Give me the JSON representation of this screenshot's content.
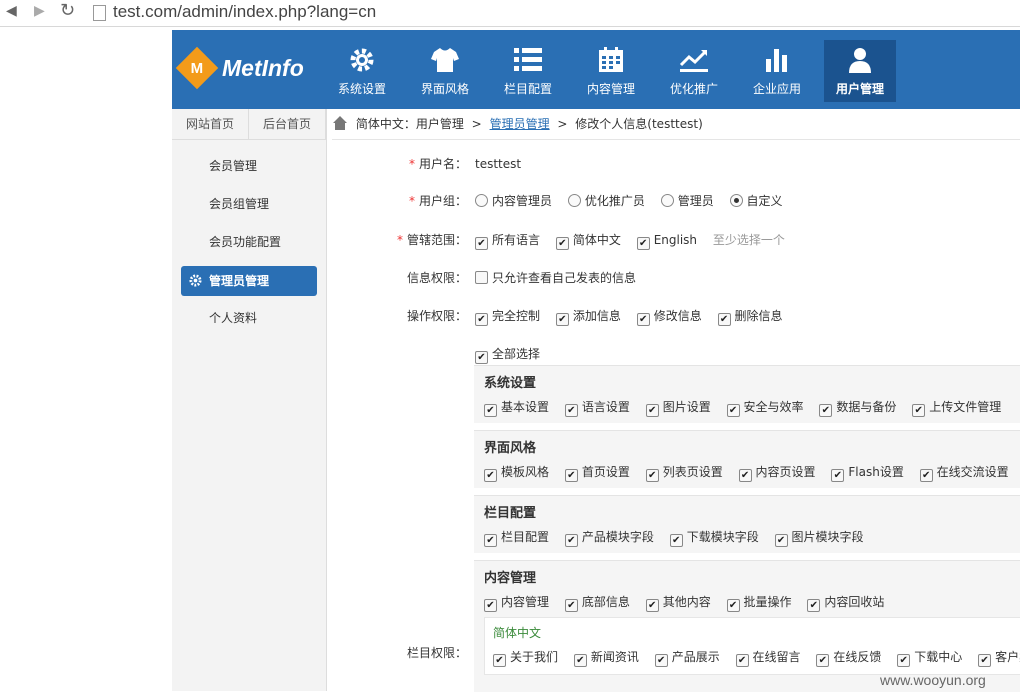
{
  "browser": {
    "url": "test.com/admin/index.php?lang=cn",
    "back": "◀",
    "forward": "▶",
    "reload": "↻"
  },
  "app": {
    "logo_letter": "M",
    "logo_text": "MetInfo"
  },
  "nav": [
    {
      "label": "系统设置",
      "icon": "gear-icon"
    },
    {
      "label": "界面风格",
      "icon": "tshirt-icon"
    },
    {
      "label": "栏目配置",
      "icon": "list-icon"
    },
    {
      "label": "内容管理",
      "icon": "calendar-icon"
    },
    {
      "label": "优化推广",
      "icon": "trend-icon"
    },
    {
      "label": "企业应用",
      "icon": "bar-chart-icon"
    },
    {
      "label": "用户管理",
      "icon": "user-icon"
    }
  ],
  "sidebar": {
    "top": [
      "网站首页",
      "后台首页"
    ],
    "items": [
      "会员管理",
      "会员组管理",
      "会员功能配置",
      "管理员管理",
      "个人资料"
    ]
  },
  "breadcrumb": {
    "part1": "简体中文：用户管理",
    "sep": ">",
    "link": "管理员管理",
    "current": "修改个人信息(testtest)"
  },
  "form": {
    "username": {
      "label": "用户名：",
      "value": "testtest"
    },
    "usergroup": {
      "label": "用户组：",
      "options": [
        "内容管理员",
        "优化推广员",
        "管理员",
        "自定义"
      ]
    },
    "scope": {
      "label": "管辖范围：",
      "options": [
        "所有语言",
        "简体中文",
        "English"
      ],
      "hint": "至少选择一个"
    },
    "info_perm": {
      "label": "信息权限：",
      "option": "只允许查看自己发表的信息"
    },
    "op_perm": {
      "label": "操作权限：",
      "options": [
        "完全控制",
        "添加信息",
        "修改信息",
        "删除信息"
      ]
    },
    "column_perm": {
      "label": "栏目权限：",
      "select_all": "全部选择"
    }
  },
  "groups": [
    {
      "title": "系统设置",
      "items": [
        "基本设置",
        "语言设置",
        "图片设置",
        "安全与效率",
        "数据与备份",
        "上传文件管理"
      ]
    },
    {
      "title": "界面风格",
      "items": [
        "模板风格",
        "首页设置",
        "列表页设置",
        "内容页设置",
        "Flash设置",
        "在线交流设置"
      ]
    },
    {
      "title": "栏目配置",
      "items": [
        "栏目配置",
        "产品模块字段",
        "下载模块字段",
        "图片模块字段"
      ]
    },
    {
      "title": "内容管理",
      "items": [
        "内容管理",
        "底部信息",
        "其他内容",
        "批量操作",
        "内容回收站"
      ]
    }
  ],
  "subgroup": {
    "title": "简体中文",
    "items": [
      "关于我们",
      "新闻资讯",
      "产品展示",
      "在线留言",
      "在线反馈",
      "下载中心",
      "客户案例"
    ]
  },
  "watermark": "www.wooyun.org",
  "colors": {
    "brand": "#2a6fb4",
    "logo": "#f39b1a"
  }
}
